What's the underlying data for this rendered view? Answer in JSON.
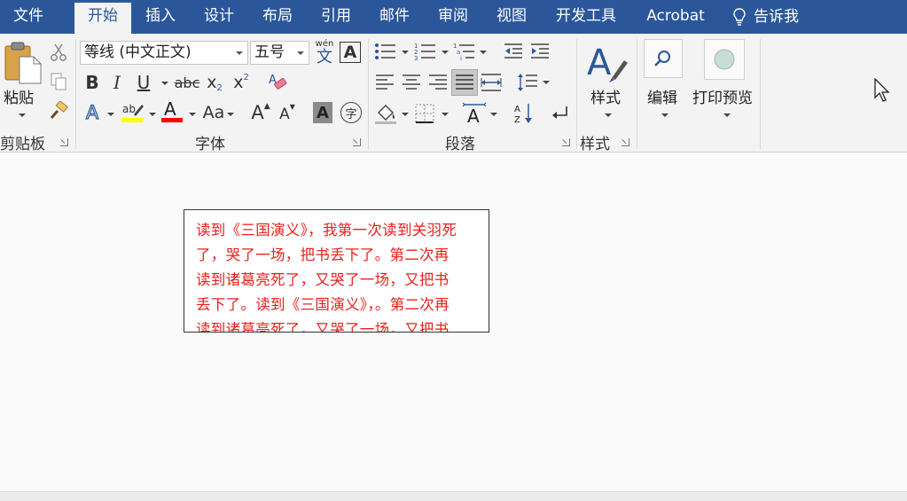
{
  "tabs": [
    {
      "label": "文件",
      "active": false
    },
    {
      "label": "开始",
      "active": true
    },
    {
      "label": "插入",
      "active": false
    },
    {
      "label": "设计",
      "active": false
    },
    {
      "label": "布局",
      "active": false
    },
    {
      "label": "引用",
      "active": false
    },
    {
      "label": "邮件",
      "active": false
    },
    {
      "label": "审阅",
      "active": false
    },
    {
      "label": "视图",
      "active": false
    },
    {
      "label": "开发工具",
      "active": false
    },
    {
      "label": "Acrobat",
      "active": false
    }
  ],
  "tell_me": {
    "label": "告诉我",
    "icon": "lightbulb-icon"
  },
  "clipboard": {
    "paste_label": "粘贴",
    "group_label": "剪贴板",
    "icons": [
      "paste-icon",
      "cut-icon",
      "copy-icon",
      "format-painter-icon"
    ]
  },
  "font": {
    "font_name": "等线 (中文正文)",
    "font_size": "五号",
    "phonetic_glyph": "文",
    "phonetic_top": "wén",
    "char_border_glyph": "A",
    "bold": "B",
    "italic": "I",
    "underline": "U",
    "strikethrough": "abc",
    "subscript": "x",
    "subscript_mark": "2",
    "superscript": "x",
    "superscript_mark": "2",
    "font_color_glyph": "A",
    "change_case": "Aa",
    "grow_font": "A",
    "shrink_font": "A",
    "char_shading_glyph": "A",
    "enclose_char_glyph": "字",
    "group_label": "字体",
    "colors": {
      "highlight": "#ffff00",
      "font_color": "#ff0000",
      "accent": "#2b579a"
    }
  },
  "paragraph": {
    "group_label": "段落",
    "icons": [
      "bullets-icon",
      "numbering-icon",
      "multilevel-list-icon",
      "decrease-indent-icon",
      "increase-indent-icon",
      "align-left-icon",
      "center-icon",
      "align-right-icon",
      "justify-icon",
      "distributed-icon",
      "line-spacing-icon",
      "shading-icon",
      "borders-icon",
      "asian-layout-icon",
      "sort-icon",
      "show-marks-icon"
    ]
  },
  "styles": {
    "label": "样式",
    "group_label": "样式"
  },
  "editing": {
    "label": "编辑"
  },
  "print_preview": {
    "label": "打印预览"
  },
  "document": {
    "textbox_lines": [
      "读到《三国演义》，我第一次读到关羽死",
      "了，哭了一场，把书丢下了。第二次再",
      "读到诸葛亮死了，又哭了一场，又把书",
      "丢下了。读到《三国演义》，。第二次再",
      "读到诸葛亮死了，又哭了一场，又把书"
    ],
    "text_color": "#e8201c"
  }
}
